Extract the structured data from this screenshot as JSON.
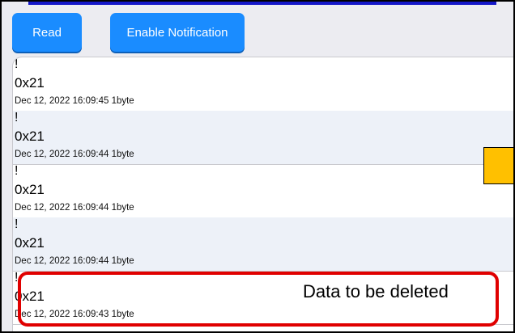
{
  "toolbar": {
    "read_label": "Read",
    "notify_label": "Enable Notification"
  },
  "list": {
    "items": [
      {
        "mark": "!",
        "value": "0x21",
        "meta": "Dec 12, 2022 16:09:45  1byte"
      },
      {
        "mark": "!",
        "value": "0x21",
        "meta": "Dec 12, 2022 16:09:44  1byte"
      },
      {
        "mark": "!",
        "value": "0x21",
        "meta": "Dec 12, 2022 16:09:44  1byte"
      },
      {
        "mark": "!",
        "value": "0x21",
        "meta": "Dec 12, 2022 16:09:44  1byte"
      },
      {
        "mark": "!",
        "value": "0x21",
        "meta": "Dec 12, 2022 16:09:43  1byte"
      }
    ]
  },
  "annotation": {
    "callout_text": "Data to be deleted"
  },
  "colors": {
    "button": "#1a8cff",
    "top_bar": "#1417c8",
    "highlight": "#e00000",
    "marker": "#ffc000"
  }
}
